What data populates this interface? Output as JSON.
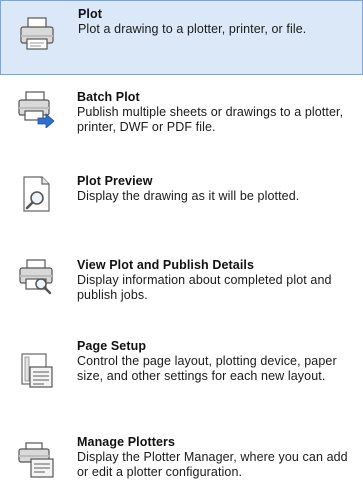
{
  "menu": {
    "items": [
      {
        "title": "Plot",
        "description": "Plot a drawing to a plotter, printer, or file.",
        "icon": "printer-icon",
        "selected": true
      },
      {
        "title": "Batch Plot",
        "description": "Publish multiple sheets or drawings to a plotter, printer, DWF or PDF file.",
        "icon": "batch-plot-icon",
        "selected": false
      },
      {
        "title": "Plot Preview",
        "description": "Display the drawing as it will be plotted.",
        "icon": "plot-preview-icon",
        "selected": false
      },
      {
        "title": "View Plot and Publish Details",
        "description": "Display information about completed plot and publish jobs.",
        "icon": "plot-details-icon",
        "selected": false
      },
      {
        "title": "Page Setup",
        "description": "Control the page layout, plotting device, paper size, and other settings for each new layout.",
        "icon": "page-setup-icon",
        "selected": false
      },
      {
        "title": "Manage Plotters",
        "description": "Display the Plotter Manager, where you can add or edit a plotter configuration.",
        "icon": "manage-plotters-icon",
        "selected": false
      }
    ]
  },
  "colors": {
    "selected_background": "#dbe8f8",
    "selected_border": "#7aa7d9",
    "arrow_blue": "#2f6fd0"
  }
}
